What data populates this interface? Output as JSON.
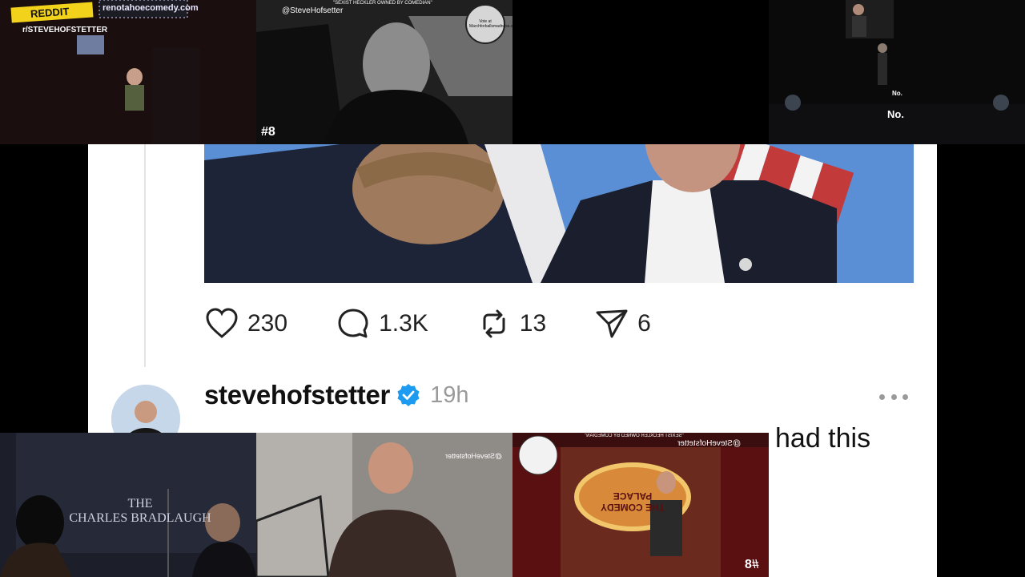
{
  "overlay_top_left": {
    "reddit_label": "REDDIT",
    "subreddit": "r/STEVEHOFSTETTER",
    "marquee": "renotahoecomedy.com"
  },
  "overlay_top_middle": {
    "headline": "\"SEXIST HECKLER OWNED BY COMEDIAN\"",
    "handle": "@SteveHofsetter",
    "badge_text": "Vote at Marchforballsmadness.com",
    "episode": "#8"
  },
  "overlay_top_right": {
    "caption_small": "No.",
    "caption_large": "No."
  },
  "post": {
    "actions": {
      "likes": "230",
      "comments": "1.3K",
      "reposts": "13",
      "shares": "6"
    }
  },
  "reply": {
    "username": "stevehofstetter",
    "time": "19h",
    "text_visible": "had this"
  },
  "overlay_bottom_left": {
    "venue": "THE\nCHARLES BRADLAUGH"
  },
  "overlay_bottom_middle": {
    "handle_mirrored": "@SteveHofstetter"
  },
  "overlay_bottom_right": {
    "headline_mirrored": "\"SEXIST HECKLER OWNED BY COMEDIAN\"",
    "handle_mirrored": "@SteveHofstetter",
    "sign": "THE COMEDY PALACE",
    "episode_mirrored": "#8"
  },
  "colors": {
    "verified": "#1d9bf0",
    "reddit_yellow": "#f3d21c",
    "sky": "#5a8fd6"
  }
}
